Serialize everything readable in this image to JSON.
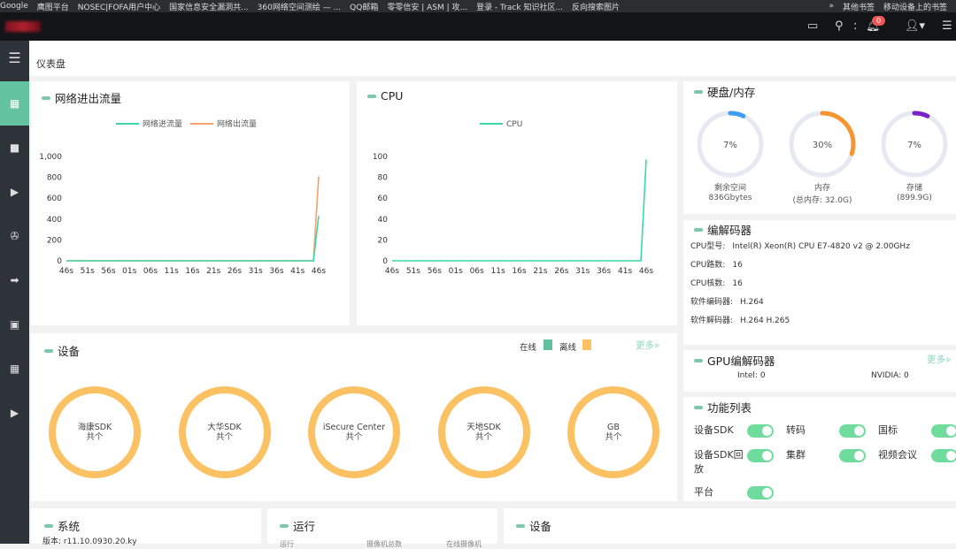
{
  "bookmarks": [
    "Google",
    "鹰图平台",
    "NOSEC|FOFA用户中心",
    "国家信息安全漏洞共...",
    "360网络空间测绘 — ...",
    "QQ邮箱",
    "零零信安 | ASM | 攻...",
    "登录 - Track 知识社区...",
    "反向搜索图片"
  ],
  "bookmarks_right": [
    "»",
    "其他书签",
    "移动设备上的书签"
  ],
  "topbar": {
    "notification_count": "0",
    "icons": [
      "screen-icon",
      "search-icon",
      "more-icon",
      "bell-icon",
      "user-icon",
      "menu-icon"
    ]
  },
  "sidebar": {
    "items": [
      "dashboard-icon",
      "camera-icon",
      "play-icon",
      "aperture-icon",
      "folder-icon",
      "monitor-user-icon",
      "grid-icon",
      "video-icon"
    ],
    "active": 0
  },
  "breadcrumb": "仪表盘",
  "traffic": {
    "title": "网络进出流量"
  },
  "cpu": {
    "title": "CPU"
  },
  "chart_data": [
    {
      "type": "line",
      "legend_position": "top",
      "xlabels": [
        "46s",
        "51s",
        "56s",
        "01s",
        "06s",
        "11s",
        "16s",
        "21s",
        "26s",
        "31s",
        "36s",
        "41s",
        "46s"
      ],
      "yticks": [
        "0",
        "200",
        "400",
        "600",
        "800",
        "1,000"
      ],
      "ylim": [
        0,
        1000
      ],
      "grid": false,
      "series": [
        {
          "name": "网络进流量",
          "color": "#3dd6a8",
          "values": [
            0,
            0,
            0,
            0,
            0,
            0,
            0,
            0,
            0,
            0,
            0,
            0,
            0,
            0,
            0,
            0,
            0,
            0,
            0,
            0,
            0,
            0,
            0,
            0,
            0,
            0,
            0,
            0,
            0,
            0,
            0,
            0,
            0,
            0,
            0,
            0,
            0,
            0,
            0,
            0,
            0,
            0,
            0,
            0,
            0,
            0,
            0,
            0,
            430
          ]
        },
        {
          "name": "网络出流量",
          "color": "#f7a06a",
          "values": [
            0,
            0,
            0,
            0,
            0,
            0,
            0,
            0,
            0,
            0,
            0,
            0,
            0,
            0,
            0,
            0,
            0,
            0,
            0,
            0,
            0,
            0,
            0,
            0,
            0,
            0,
            0,
            0,
            0,
            0,
            0,
            0,
            0,
            0,
            0,
            0,
            0,
            0,
            0,
            0,
            0,
            0,
            0,
            0,
            0,
            0,
            0,
            0,
            810
          ]
        }
      ]
    },
    {
      "type": "line",
      "legend_position": "top",
      "xlabels": [
        "46s",
        "51s",
        "56s",
        "01s",
        "06s",
        "11s",
        "16s",
        "21s",
        "26s",
        "31s",
        "36s",
        "41s",
        "46s"
      ],
      "yticks": [
        "0",
        "20",
        "40",
        "60",
        "80",
        "100"
      ],
      "ylim": [
        0,
        100
      ],
      "grid": false,
      "series": [
        {
          "name": "CPU",
          "color": "#3dd6a8",
          "values": [
            0,
            0,
            0,
            0,
            0,
            0,
            0,
            0,
            0,
            0,
            0,
            0,
            0,
            0,
            0,
            0,
            0,
            0,
            0,
            0,
            0,
            0,
            0,
            0,
            0,
            0,
            0,
            0,
            0,
            0,
            0,
            0,
            0,
            0,
            0,
            0,
            0,
            0,
            0,
            0,
            0,
            0,
            0,
            0,
            0,
            0,
            0,
            0,
            97
          ]
        }
      ]
    }
  ],
  "disk": {
    "title": "硬盘/内存",
    "gauges": [
      {
        "percent": 7,
        "label": "7%",
        "name": "剩余空间",
        "sub": "836Gbytes",
        "color": "#3d9df5"
      },
      {
        "percent": 30,
        "label": "30%",
        "name": "内存",
        "sub": "(总内存: 32.0G)",
        "color": "#f7952f"
      },
      {
        "percent": 7,
        "label": "7%",
        "name": "存储",
        "sub": "(899.9G)",
        "color": "#7b22c9"
      }
    ]
  },
  "codec": {
    "title": "编解码器",
    "rows": [
      {
        "k": "CPU型号:",
        "v": "Intel(R) Xeon(R) CPU E7-4820 v2 @ 2.00GHz"
      },
      {
        "k": "CPU路数:",
        "v": "16"
      },
      {
        "k": "CPU核数:",
        "v": "16"
      },
      {
        "k": "软件编码器:",
        "v": "H.264"
      },
      {
        "k": "软件解码器:",
        "v": "H.264 H.265"
      }
    ]
  },
  "gpu": {
    "title": "GPU编解码器",
    "more": "更多»",
    "intel": "Intel: 0",
    "nvidia": "NVIDIA: 0"
  },
  "features": {
    "title": "功能列表",
    "items": [
      {
        "label": "设备SDK",
        "on": true
      },
      {
        "label": "转码",
        "on": true
      },
      {
        "label": "国标",
        "on": true
      },
      {
        "label": "设备SDK回放",
        "on": true
      },
      {
        "label": "集群",
        "on": true
      },
      {
        "label": "视频会议",
        "on": true
      },
      {
        "label": "平台",
        "on": true
      }
    ]
  },
  "devices": {
    "title": "设备",
    "online": "在线",
    "offline": "离线",
    "online_color": "#5fbf9f",
    "offline_color": "#fbc163",
    "more": "更多»",
    "rings": [
      {
        "name": "海康SDK",
        "count": "共个"
      },
      {
        "name": "大华SDK",
        "count": "共个"
      },
      {
        "name": "iSecure Center",
        "count": "共个"
      },
      {
        "name": "天地SDK",
        "count": "共个"
      },
      {
        "name": "GB",
        "count": "共个"
      }
    ]
  },
  "system": {
    "title": "系统",
    "version": "版本:  r11.10.0930.20.ky"
  },
  "running": {
    "title": "运行",
    "cols": [
      "运行",
      "摄像机总数",
      "在线摄像机"
    ]
  },
  "devices2": {
    "title": "设备"
  }
}
